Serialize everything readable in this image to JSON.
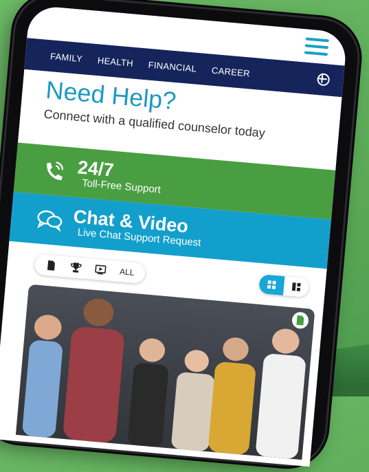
{
  "nav": {
    "items": [
      "FAMILY",
      "HEALTH",
      "FINANCIAL",
      "CAREER"
    ]
  },
  "help": {
    "title": "Need Help?",
    "subtitle": "Connect with a qualified counselor today"
  },
  "support": {
    "big": "24/7",
    "small": "Toll-Free Support"
  },
  "chat": {
    "big": "Chat & Video",
    "small": "Live Chat Support Request"
  },
  "filters": {
    "all_label": "ALL"
  },
  "colors": {
    "navy": "#15255c",
    "accent_blue": "#139fcc",
    "green": "#4a9e42"
  }
}
